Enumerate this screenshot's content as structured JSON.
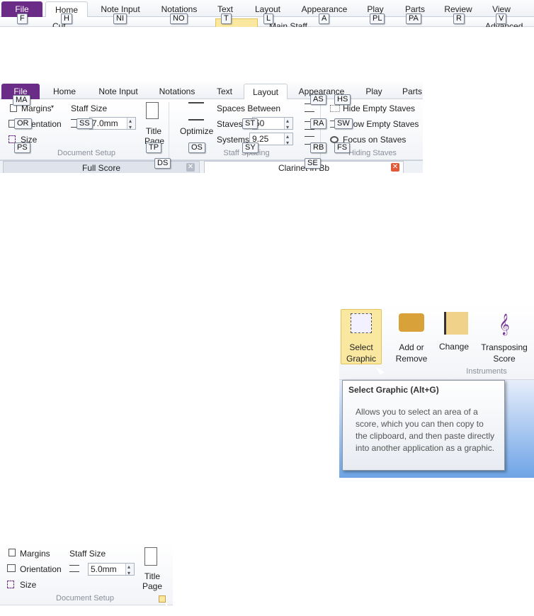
{
  "top_ribbon": {
    "tabs": [
      "File",
      "Home",
      "Note Input",
      "Notations",
      "Text",
      "Layout",
      "Appearance",
      "Play",
      "Parts",
      "Review",
      "View"
    ],
    "keytips": [
      "F",
      "H",
      "NI",
      "NO",
      "T",
      "L",
      "A",
      "PL",
      "PA",
      "R",
      "V"
    ],
    "partial_texts": {
      "cut": "Cut",
      "main_staff": "Main Staff",
      "advanced": "Advanced"
    }
  },
  "layout_ribbon": {
    "tabs": [
      "File",
      "Home",
      "Note Input",
      "Notations",
      "Text",
      "Layout",
      "Appearance",
      "Play",
      "Parts"
    ],
    "active_tab": "Layout",
    "document_setup": {
      "margins": "Margins",
      "orientation": "Orientation",
      "size": "Size",
      "staff_size_label": "Staff Size",
      "staff_size_value": "7.0mm",
      "title_page": "Title Page",
      "group_label": "Document Setup"
    },
    "staff_spacing": {
      "optimize": "Optimize",
      "spaces_between": "Spaces Between",
      "staves_label": "Staves",
      "staves_value": "50",
      "systems_label": "Systems",
      "systems_value": "9.25",
      "group_label": "Staff Spacing"
    },
    "hiding_staves": {
      "hide_empty": "Hide Empty Staves",
      "show_empty": "Show Empty Staves",
      "focus": "Focus on Staves",
      "group_label": "Hiding Staves"
    },
    "keytips": {
      "margins": "MA",
      "orientation": "OR",
      "size": "PS",
      "staff_size": "SS",
      "title_page": "TP",
      "dialog": "DS",
      "optimize": "OS",
      "staves": "ST",
      "systems": "SY",
      "as": "AS",
      "ra": "RA",
      "rb": "RB",
      "se": "SE",
      "hide": "HS",
      "show": "SW",
      "focus": "FS"
    },
    "doc_tabs": {
      "full_score": "Full Score",
      "clarinet": "Clarinet in Bb"
    }
  },
  "instruments_panel": {
    "select_graphic": "Select Graphic",
    "add_or_remove": "Add or Remove",
    "change": "Change",
    "transposing_score": "Transposing Score",
    "group_label": "Instruments",
    "tooltip_title": "Select Graphic (Alt+G)",
    "tooltip_body": "Allows you to select an area of a score, which you can then copy to the clipboard, and then paste directly into another application as a graphic."
  },
  "doc_setup_small": {
    "margins": "Margins",
    "orientation": "Orientation",
    "size": "Size",
    "staff_size_label": "Staff Size",
    "staff_size_value": "5.0mm",
    "title_page": "Title Page",
    "group_label": "Document Setup"
  },
  "colors": {
    "file_tab": "#6a2c86",
    "active_tab_border": "#c9cfd8",
    "highlight": "#fbe8a0",
    "close": "#e0593a"
  }
}
